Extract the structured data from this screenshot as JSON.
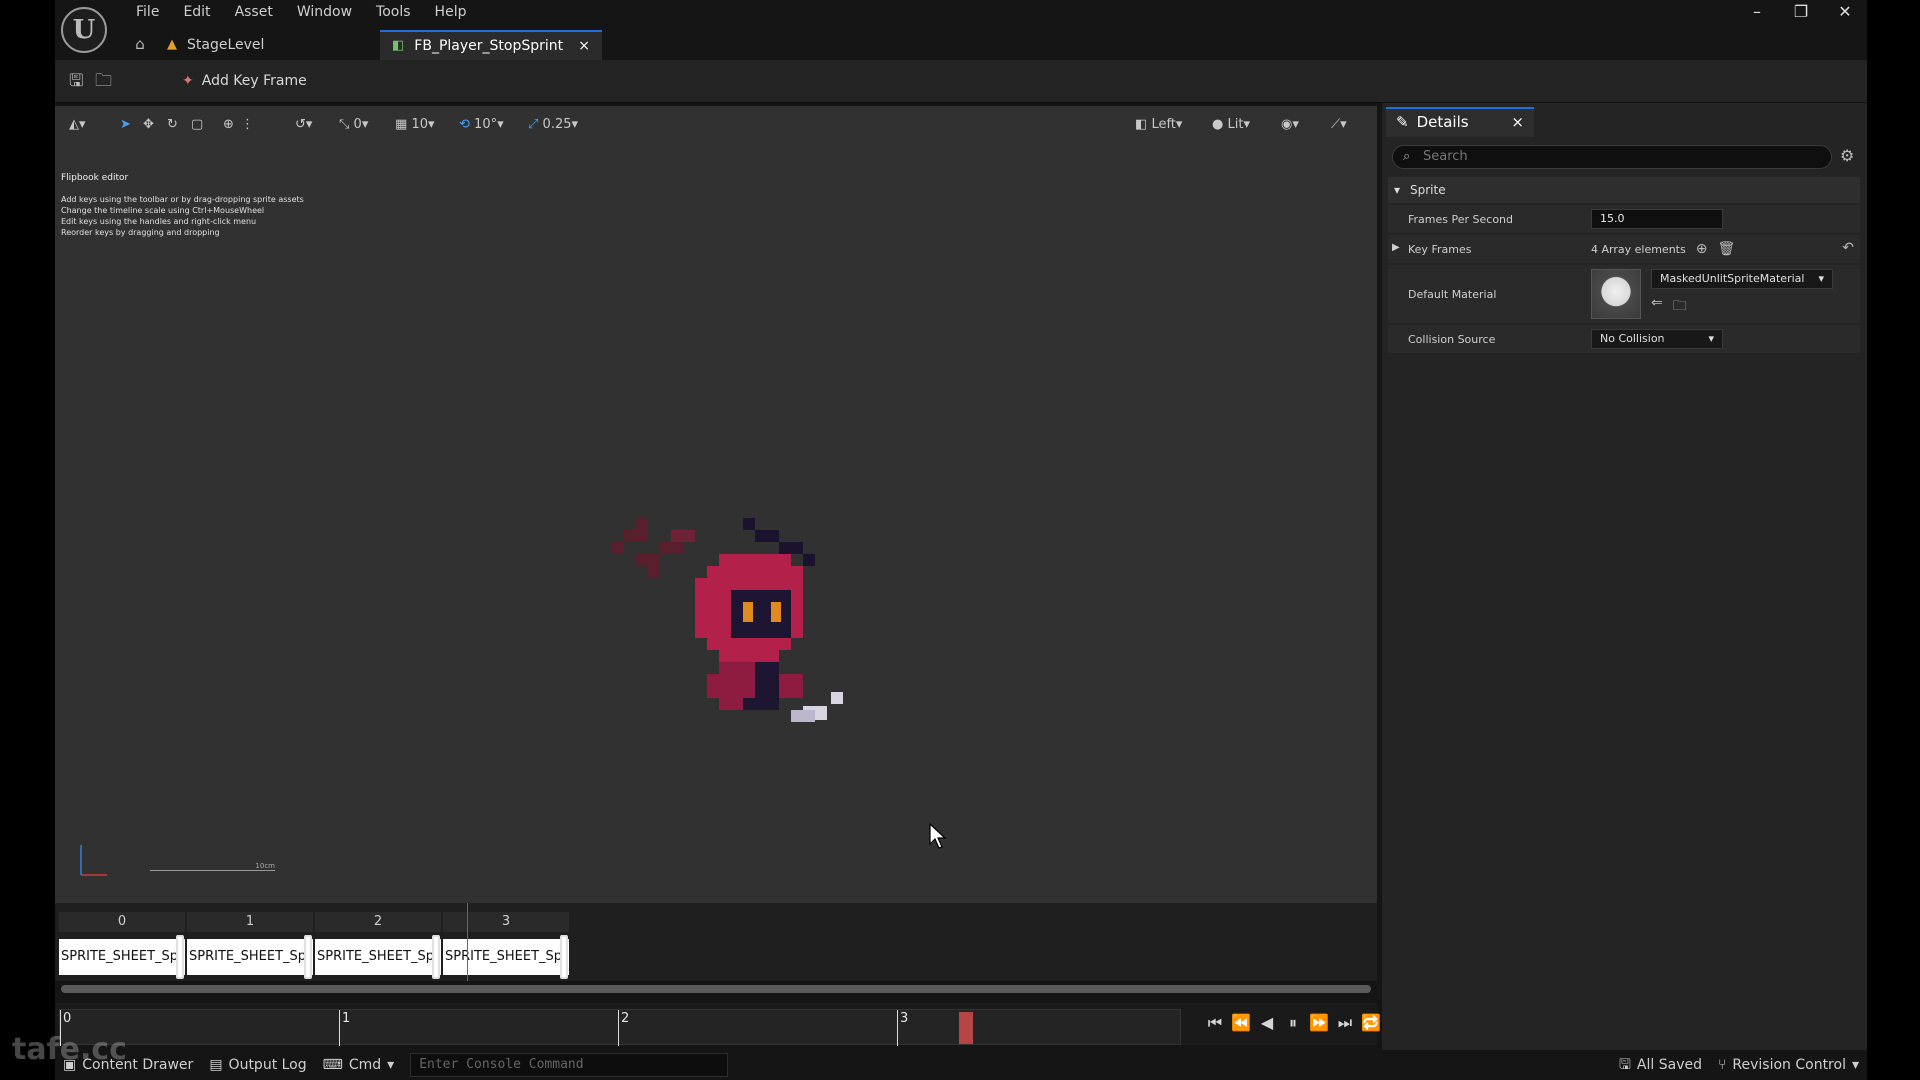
{
  "menu": [
    "File",
    "Edit",
    "Asset",
    "Window",
    "Tools",
    "Help"
  ],
  "tabs": {
    "level": "StageLevel",
    "asset": "FB_Player_StopSprint"
  },
  "toolbar": {
    "add_key_frame": "Add Key Frame"
  },
  "viewport_toolbar": {
    "translate_snap": "0",
    "grid_size": "10",
    "rotation_snap": "10°",
    "scale_snap": "0.25",
    "view": "Left",
    "lighting": "Lit"
  },
  "help": {
    "title": "Flipbook editor",
    "lines": [
      "Add keys using the toolbar or by drag-dropping sprite assets",
      "Change the timeline scale using Ctrl+MouseWheel",
      "Edit keys using the handles and right-click menu",
      "Reorder keys by dragging and dropping"
    ]
  },
  "scale_label": "10cm",
  "keyframes": [
    {
      "index": "0",
      "label": "SPRITE_SHEET_Sp"
    },
    {
      "index": "1",
      "label": "SPRITE_SHEET_Sp"
    },
    {
      "index": "2",
      "label": "SPRITE_SHEET_Sp"
    },
    {
      "index": "3",
      "label": "SPRITE_SHEET_Sp"
    }
  ],
  "ruler_ticks": [
    "0",
    "1",
    "2",
    "3"
  ],
  "statusbar": {
    "content_drawer": "Content Drawer",
    "output_log": "Output Log",
    "cmd": "Cmd",
    "console_placeholder": "Enter Console Command",
    "all_saved": "All Saved",
    "revision_control": "Revision Control"
  },
  "details": {
    "tab_title": "Details",
    "search_placeholder": "Search",
    "category": "Sprite",
    "fps_label": "Frames Per Second",
    "fps_value": "15.0",
    "key_frames_label": "Key Frames",
    "key_frames_value": "4 Array elements",
    "default_material_label": "Default Material",
    "default_material_value": "MaskedUnlitSpriteMaterial",
    "collision_label": "Collision Source",
    "collision_value": "No Collision"
  },
  "watermark": "tafe.cc",
  "colors": {
    "accent": "#1f6fdc",
    "playhead": "#c84040"
  }
}
